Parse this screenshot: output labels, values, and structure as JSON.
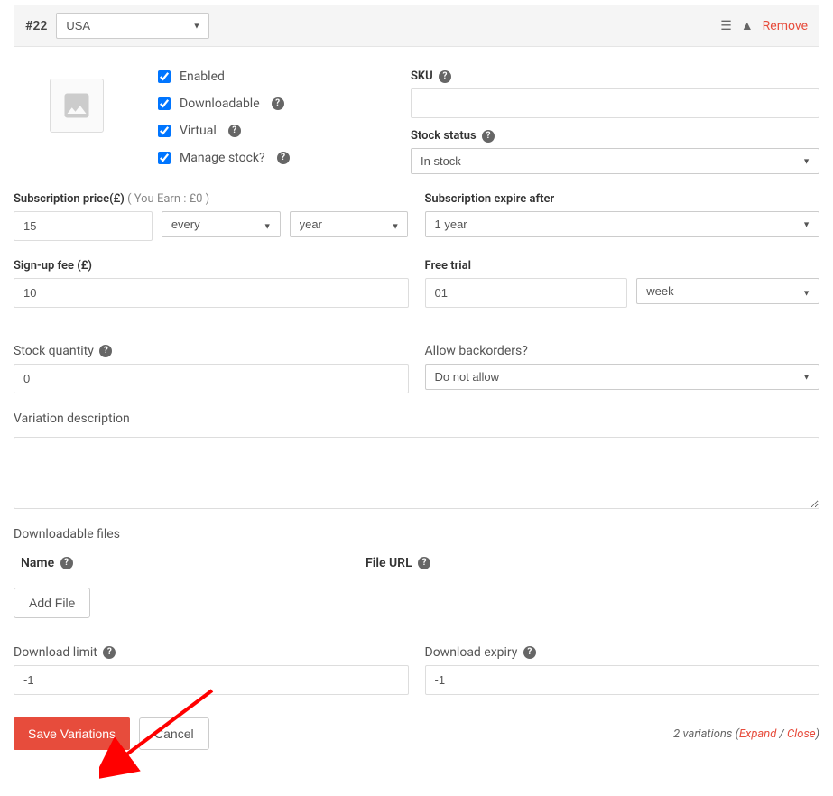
{
  "header": {
    "variation_id": "#22",
    "attribute_select": "USA",
    "remove_label": "Remove"
  },
  "checks": {
    "enabled": "Enabled",
    "downloadable": "Downloadable",
    "virtual": "Virtual",
    "manage_stock": "Manage stock?"
  },
  "sku": {
    "label": "SKU",
    "value": ""
  },
  "stock_status": {
    "label": "Stock status",
    "value": "In stock"
  },
  "subscription_price": {
    "label": "Subscription price(£)",
    "you_earn": "( You Earn : £0 )",
    "value": "15",
    "period_prefix": "every",
    "period_unit": "year"
  },
  "subscription_expire": {
    "label": "Subscription expire after",
    "value": "1 year"
  },
  "signup_fee": {
    "label": "Sign-up fee (£)",
    "value": "10"
  },
  "free_trial": {
    "label": "Free trial",
    "value": "01",
    "unit": "week"
  },
  "stock_qty": {
    "label": "Stock quantity",
    "value": "0"
  },
  "backorders": {
    "label": "Allow backorders?",
    "value": "Do not allow"
  },
  "description": {
    "label": "Variation description",
    "value": ""
  },
  "downloads": {
    "label": "Downloadable files",
    "th_name": "Name",
    "th_url": "File URL",
    "add_btn": "Add File"
  },
  "download_limit": {
    "label": "Download limit",
    "value": "-1"
  },
  "download_expiry": {
    "label": "Download expiry",
    "value": "-1"
  },
  "footer": {
    "save": "Save Variations",
    "cancel": "Cancel",
    "count_text": "2 variations",
    "expand": "Expand",
    "close": "Close"
  }
}
